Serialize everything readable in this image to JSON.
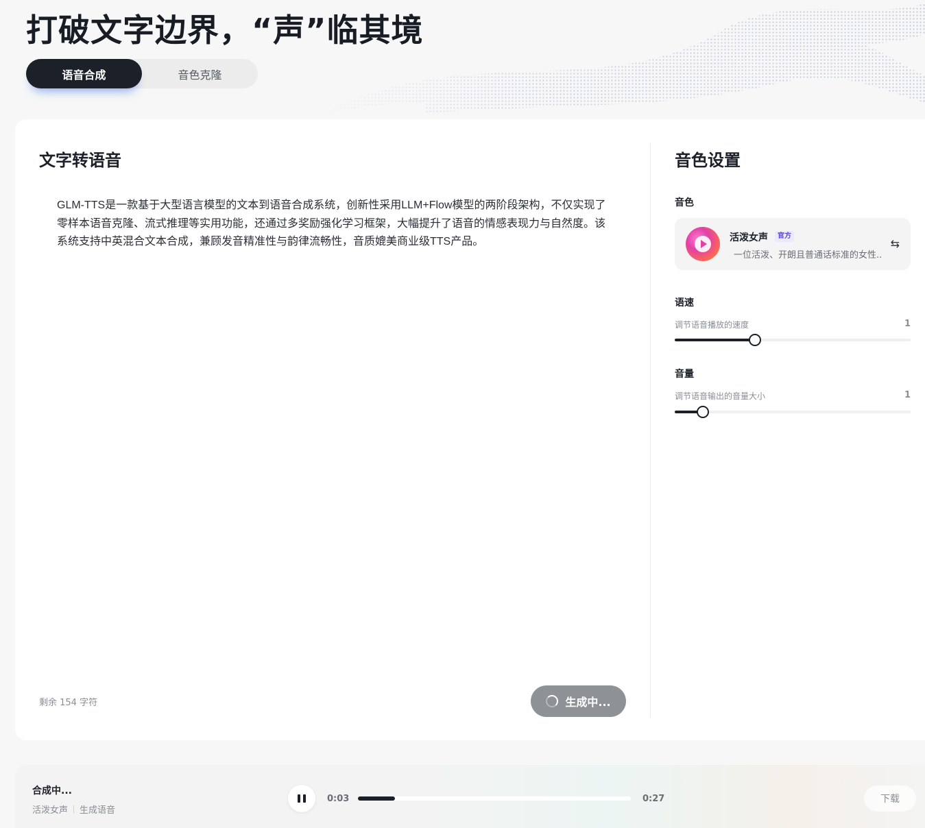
{
  "hero": {
    "title": "打破文字边界，“声”临其境",
    "tabs": [
      "语音合成",
      "音色克隆"
    ]
  },
  "tts": {
    "section_title": "文字转语音",
    "text": "GLM-TTS是一款基于大型语言模型的文本到语音合成系统，创新性采用LLM+Flow模型的两阶段架构，不仅实现了零样本语音克隆、流式推理等实用功能，还通过多奖励强化学习框架，大幅提升了语音的情感表现力与自然度。该系统支持中英混合文本合成，兼顾发音精准性与韵律流畅性，音质媲美商业级TTS产品。",
    "char_count": "剩余 154 字符",
    "generate_label": "生成中..."
  },
  "settings": {
    "section_title": "音色设置",
    "voice_label": "音色",
    "voice": {
      "name": "活泼女声",
      "badge": "官方",
      "description": "一位活泼、开朗且普通话标准的女性.."
    },
    "speed": {
      "label": "语速",
      "hint": "调节语音播放的速度",
      "value": "1",
      "level": 0.34
    },
    "volume": {
      "label": "音量",
      "hint": "调节语音输出的音量大小",
      "value": "1",
      "level": 0.12
    }
  },
  "player": {
    "title": "合成中...",
    "voice": "活泼女声",
    "action": "生成语音",
    "current_time": "0:03",
    "total_time": "0:27",
    "progress": 0.135,
    "download_label": "下载"
  }
}
